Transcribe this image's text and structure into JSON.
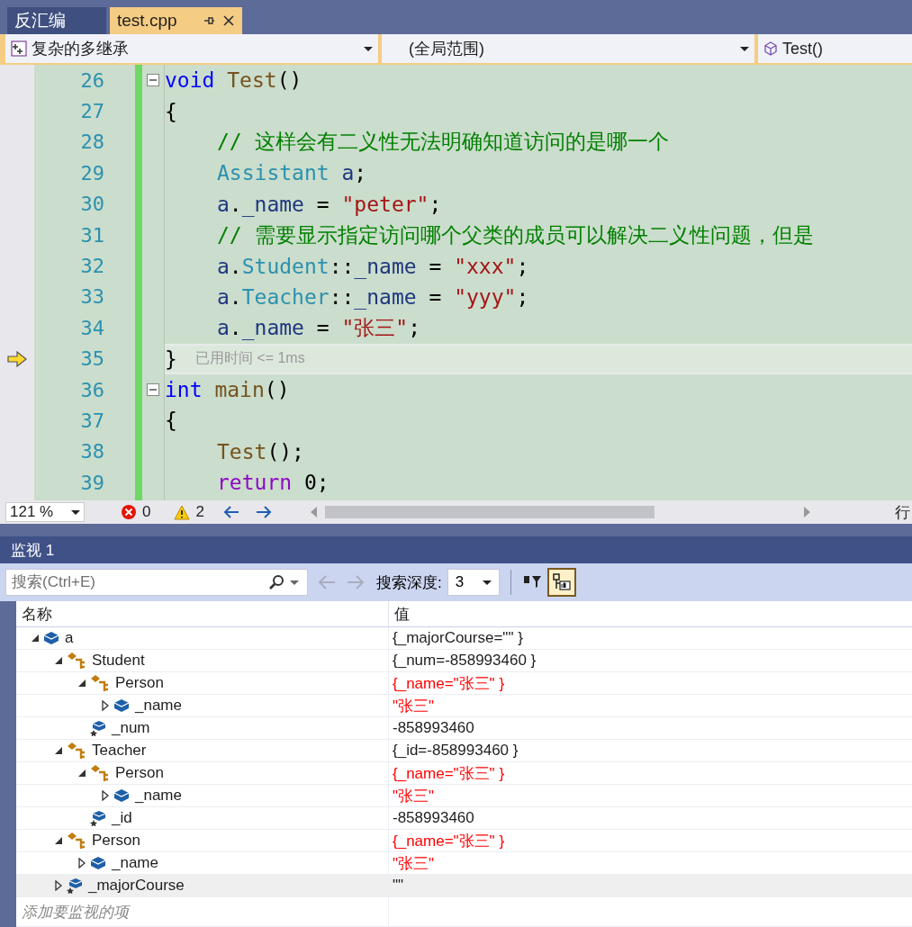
{
  "tabs": [
    {
      "label": "反汇编",
      "selected": false,
      "pinned": false
    },
    {
      "label": "test.cpp",
      "selected": true,
      "pinned": true
    }
  ],
  "nav": {
    "project": "复杂的多继承",
    "scope": "(全局范围)",
    "member": "Test()"
  },
  "editor": {
    "lines": [
      {
        "number": "26",
        "fold": true,
        "indented": false,
        "current": false,
        "tokens": [
          {
            "kind": "kw",
            "text": "void "
          },
          {
            "kind": "fn",
            "text": "Test"
          },
          {
            "kind": "plain",
            "text": "()"
          }
        ]
      },
      {
        "number": "27",
        "fold": false,
        "indented": false,
        "current": false,
        "tokens": [
          {
            "kind": "plain",
            "text": "{"
          }
        ]
      },
      {
        "number": "28",
        "fold": false,
        "indented": true,
        "current": false,
        "tokens": [
          {
            "kind": "cm",
            "text": "// 这样会有二义性无法明确知道访问的是哪一个"
          }
        ]
      },
      {
        "number": "29",
        "fold": false,
        "indented": true,
        "current": false,
        "tokens": [
          {
            "kind": "type",
            "text": "Assistant "
          },
          {
            "kind": "var",
            "text": "a"
          },
          {
            "kind": "plain",
            "text": ";"
          }
        ]
      },
      {
        "number": "30",
        "fold": false,
        "indented": true,
        "current": false,
        "tokens": [
          {
            "kind": "var",
            "text": "a"
          },
          {
            "kind": "plain",
            "text": "."
          },
          {
            "kind": "var",
            "text": "_name"
          },
          {
            "kind": "plain",
            "text": " = "
          },
          {
            "kind": "str",
            "text": "\"peter\""
          },
          {
            "kind": "plain",
            "text": ";"
          }
        ]
      },
      {
        "number": "31",
        "fold": false,
        "indented": true,
        "current": false,
        "tokens": [
          {
            "kind": "cm",
            "text": "// 需要显示指定访问哪个父类的成员可以解决二义性问题，但是"
          }
        ]
      },
      {
        "number": "32",
        "fold": false,
        "indented": true,
        "current": false,
        "tokens": [
          {
            "kind": "var",
            "text": "a"
          },
          {
            "kind": "plain",
            "text": "."
          },
          {
            "kind": "type",
            "text": "Student"
          },
          {
            "kind": "plain",
            "text": "::"
          },
          {
            "kind": "var",
            "text": "_name"
          },
          {
            "kind": "plain",
            "text": " = "
          },
          {
            "kind": "str",
            "text": "\"xxx\""
          },
          {
            "kind": "plain",
            "text": ";"
          }
        ]
      },
      {
        "number": "33",
        "fold": false,
        "indented": true,
        "current": false,
        "tokens": [
          {
            "kind": "var",
            "text": "a"
          },
          {
            "kind": "plain",
            "text": "."
          },
          {
            "kind": "type",
            "text": "Teacher"
          },
          {
            "kind": "plain",
            "text": "::"
          },
          {
            "kind": "var",
            "text": "_name"
          },
          {
            "kind": "plain",
            "text": " = "
          },
          {
            "kind": "str",
            "text": "\"yyy\""
          },
          {
            "kind": "plain",
            "text": ";"
          }
        ]
      },
      {
        "number": "34",
        "fold": false,
        "indented": true,
        "current": false,
        "tokens": [
          {
            "kind": "var",
            "text": "a"
          },
          {
            "kind": "plain",
            "text": "."
          },
          {
            "kind": "var",
            "text": "_name"
          },
          {
            "kind": "plain",
            "text": " = "
          },
          {
            "kind": "str",
            "text": "\"张三\""
          },
          {
            "kind": "plain",
            "text": ";"
          }
        ]
      },
      {
        "number": "35",
        "fold": false,
        "indented": false,
        "current": true,
        "hint": "已用时间 <= 1ms",
        "tokens": [
          {
            "kind": "plain",
            "text": "}"
          }
        ]
      },
      {
        "number": "36",
        "fold": true,
        "indented": false,
        "current": false,
        "tokens": [
          {
            "kind": "kw",
            "text": "int "
          },
          {
            "kind": "fn",
            "text": "main"
          },
          {
            "kind": "plain",
            "text": "()"
          }
        ]
      },
      {
        "number": "37",
        "fold": false,
        "indented": false,
        "current": false,
        "tokens": [
          {
            "kind": "plain",
            "text": "{"
          }
        ]
      },
      {
        "number": "38",
        "fold": false,
        "indented": true,
        "current": false,
        "tokens": [
          {
            "kind": "fn",
            "text": "Test"
          },
          {
            "kind": "plain",
            "text": "();"
          }
        ]
      },
      {
        "number": "39",
        "fold": false,
        "indented": true,
        "current": false,
        "tokens": [
          {
            "kind": "ctl",
            "text": "return"
          },
          {
            "kind": "plain",
            "text": " 0;"
          }
        ]
      }
    ]
  },
  "status": {
    "zoom": "121 %",
    "errors": "0",
    "warnings": "2",
    "position_label": "行"
  },
  "watch": {
    "title": "监视 1",
    "search_placeholder": "搜索(Ctrl+E)",
    "depth_label": "搜索深度:",
    "depth": "3",
    "columns": [
      "名称",
      "值"
    ],
    "items": [
      {
        "name": "a",
        "kind": "object",
        "expanded": true,
        "changed": false,
        "selected": false,
        "value": "{_majorCourse=\"\" }",
        "children": [
          {
            "name": "Student",
            "kind": "base",
            "expanded": true,
            "changed": false,
            "selected": false,
            "value": "{_num=-858993460 }",
            "children": [
              {
                "name": "Person",
                "kind": "base",
                "expanded": true,
                "changed": true,
                "selected": false,
                "value": "{_name=\"张三\" }",
                "children": [
                  {
                    "name": "_name",
                    "kind": "object",
                    "expanded": false,
                    "changed": true,
                    "selected": false,
                    "value": "\"张三\""
                  }
                ]
              },
              {
                "name": "_num",
                "kind": "field",
                "changed": false,
                "selected": false,
                "value": "-858993460"
              }
            ]
          },
          {
            "name": "Teacher",
            "kind": "base",
            "expanded": true,
            "changed": false,
            "selected": false,
            "value": "{_id=-858993460 }",
            "children": [
              {
                "name": "Person",
                "kind": "base",
                "expanded": true,
                "changed": true,
                "selected": false,
                "value": "{_name=\"张三\" }",
                "children": [
                  {
                    "name": "_name",
                    "kind": "object",
                    "expanded": false,
                    "changed": true,
                    "selected": false,
                    "value": "\"张三\""
                  }
                ]
              },
              {
                "name": "_id",
                "kind": "field",
                "changed": false,
                "selected": false,
                "value": "-858993460"
              }
            ]
          },
          {
            "name": "Person",
            "kind": "base",
            "expanded": true,
            "changed": true,
            "selected": false,
            "value": "{_name=\"张三\" }",
            "children": [
              {
                "name": "_name",
                "kind": "object",
                "expanded": false,
                "changed": true,
                "selected": false,
                "value": "\"张三\""
              }
            ]
          },
          {
            "name": "_majorCourse",
            "kind": "field",
            "expanded": false,
            "changed": false,
            "selected": true,
            "value": "\"\""
          }
        ]
      }
    ],
    "add_item_hint": "添加要监视的项"
  }
}
